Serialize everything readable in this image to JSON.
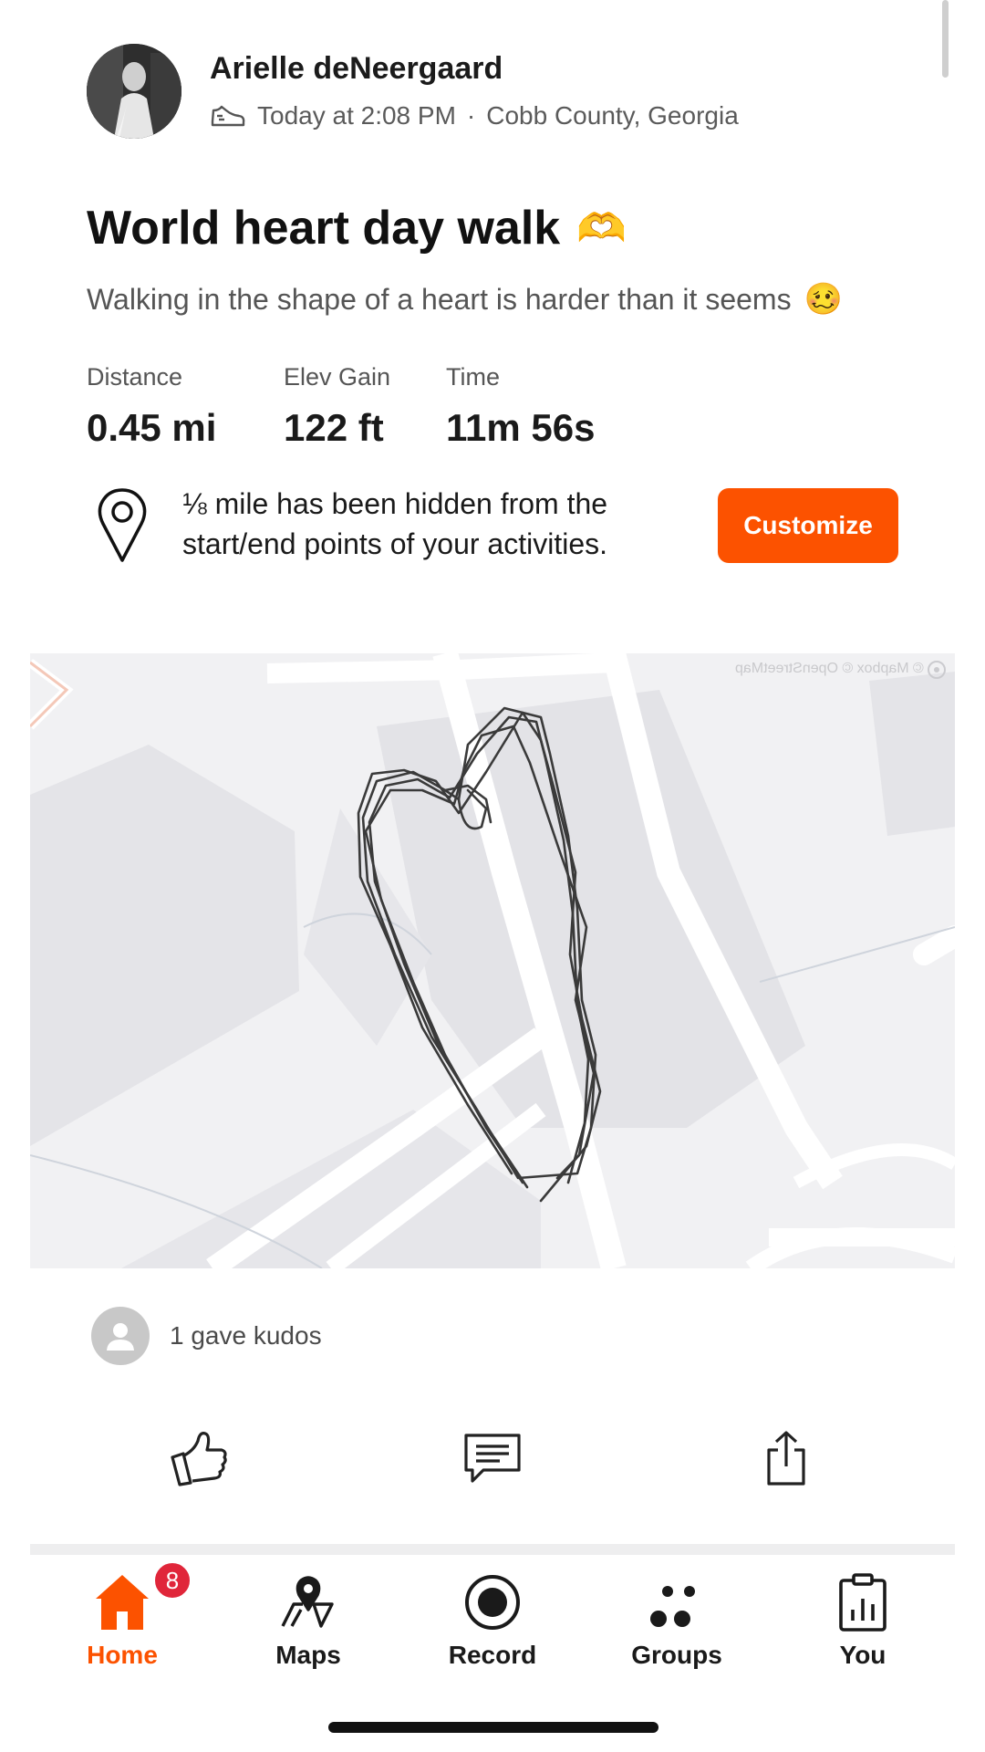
{
  "activity": {
    "owner_name": "Arielle deNeergaard",
    "timestamp": "Today at 2:08 PM",
    "separator": "·",
    "location": "Cobb County, Georgia",
    "sport_icon": "walking-shoe-icon",
    "title": "World heart day walk",
    "title_emoji": "🫶",
    "description": "Walking in the shape of a heart is harder than it seems",
    "description_emoji": "🥴"
  },
  "stats": [
    {
      "label": "Distance",
      "value": "0.45 mi"
    },
    {
      "label": "Elev Gain",
      "value": "122 ft"
    },
    {
      "label": "Time",
      "value": "11m 56s"
    }
  ],
  "privacy": {
    "message": "⅛ mile has been hidden from the start/end points of your activities.",
    "button_label": "Customize",
    "icon": "location-pin-icon"
  },
  "map": {
    "attribution": "© Mapbox © OpenStreetMap"
  },
  "kudos": {
    "text": "1 gave kudos"
  },
  "actions": [
    {
      "name": "kudos",
      "icon": "thumbs-up-icon"
    },
    {
      "name": "comment",
      "icon": "comment-icon"
    },
    {
      "name": "share",
      "icon": "share-icon"
    }
  ],
  "tabs": [
    {
      "label": "Home",
      "icon": "home-icon",
      "badge": "8",
      "active": true
    },
    {
      "label": "Maps",
      "icon": "map-icon"
    },
    {
      "label": "Record",
      "icon": "record-icon"
    },
    {
      "label": "Groups",
      "icon": "groups-icon"
    },
    {
      "label": "You",
      "icon": "you-icon"
    }
  ],
  "colors": {
    "accent": "#fc5200",
    "badge": "#e0263a",
    "map_bg": "#f1f1f3",
    "route": "#3a3a3a"
  }
}
